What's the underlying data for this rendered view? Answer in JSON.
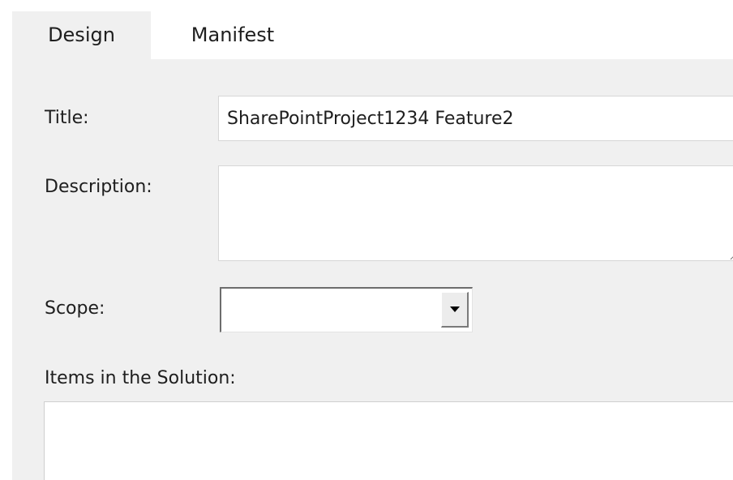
{
  "tabs": [
    {
      "label": "Design",
      "selected": true
    },
    {
      "label": "Manifest",
      "selected": false
    }
  ],
  "form": {
    "title_label": "Title:",
    "title_value": "SharePointProject1234 Feature2",
    "description_label": "Description:",
    "description_value": "",
    "scope_label": "Scope:",
    "scope_value": "",
    "items_label": "Items in the Solution:"
  },
  "icons": {
    "scope_dropdown": "dropdown-arrow-icon"
  },
  "colors": {
    "panel_background": "#f0f0f0",
    "input_background": "#ffffff"
  }
}
